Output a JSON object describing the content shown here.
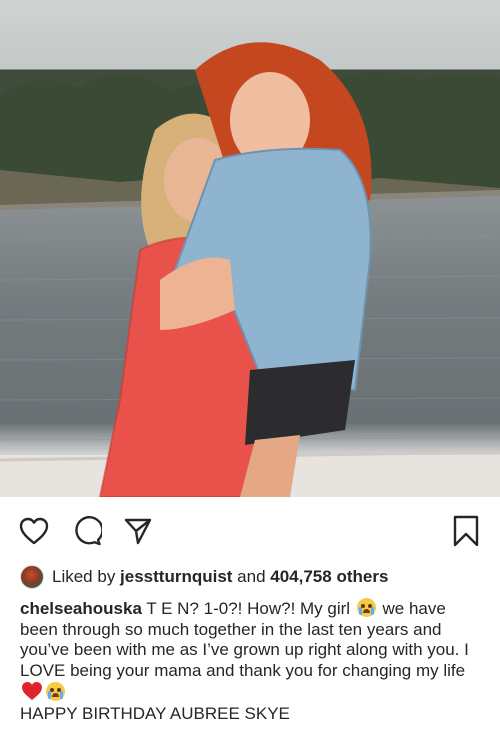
{
  "post": {
    "liked_by_prefix": "Liked by ",
    "liked_by_user": "jesstturnquist",
    "liked_by_middle": " and ",
    "liked_by_others": "404,758 others",
    "caption_user": "chelseahouska",
    "caption_part1": " T E N? 1-0?! How?! My girl ",
    "caption_part2": " we have been through so much together in the last ten years and you’ve been with me as I’ve grown up right along with you. I LOVE being your mama and thank you for changing my life ",
    "caption_line2": "HAPPY BIRTHDAY AUBREE SKYE"
  },
  "icons": {
    "like": "heart-outline-icon",
    "comment": "comment-bubble-icon",
    "share": "paper-plane-icon",
    "save": "bookmark-icon",
    "emoji_1": "crying-face-emoji",
    "emoji_2": "red-heart-emoji",
    "emoji_3": "crying-face-emoji"
  }
}
